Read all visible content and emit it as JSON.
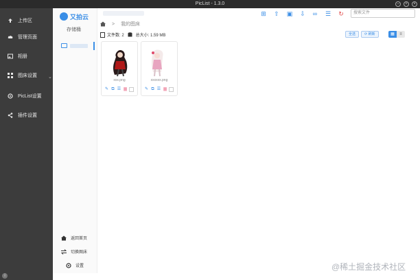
{
  "window": {
    "title": "PicList - 1.3.0"
  },
  "sidebar": {
    "items": [
      {
        "label": "上传区",
        "icon": "upload-icon"
      },
      {
        "label": "管理页面",
        "icon": "cloud-icon"
      },
      {
        "label": "相册",
        "icon": "image-icon"
      },
      {
        "label": "图床设置",
        "icon": "grid-icon"
      },
      {
        "label": "PicList设置",
        "icon": "gear-icon"
      },
      {
        "label": "插件设置",
        "icon": "share-icon"
      }
    ],
    "chevron": "⌄"
  },
  "panel": {
    "logo": "又拍云",
    "subtitle": "存储桶",
    "footer": [
      {
        "label": "返回首页",
        "icon": "home-icon"
      },
      {
        "label": "切换图床",
        "icon": "switch-icon"
      },
      {
        "label": "设置",
        "icon": "gear-icon"
      }
    ]
  },
  "toolbar": {
    "search_placeholder": "搜索文件"
  },
  "breadcrumb": {
    "separator": ">",
    "current": "我的图床"
  },
  "stats": {
    "file_count_label": "文件数: 2",
    "total_size_label": "总大小: 1.59 MB"
  },
  "actions": {
    "select_all": "全选",
    "refresh": "刷新"
  },
  "files": [
    {
      "name": "xxx.png"
    },
    {
      "name": "xxxxxx.png"
    }
  ],
  "colors": {
    "accent": "#3a8ee6",
    "sidebar_bg": "#3c3c3c",
    "delete": "#f2a6b8",
    "refresh": "#e04a4a"
  },
  "watermark": "@稀土掘金技术社区"
}
